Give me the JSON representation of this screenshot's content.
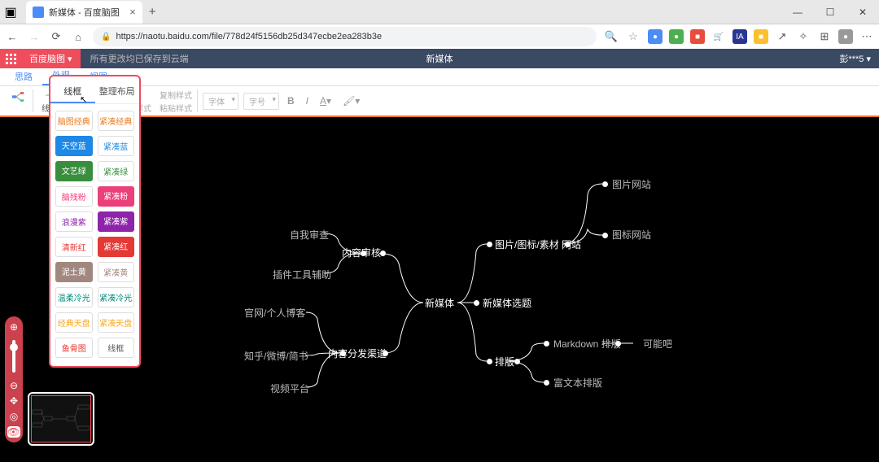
{
  "browser": {
    "tab_title": "新媒体 - 百度脑图",
    "url": "https://naotu.baidu.com/file/778d24f5156db25d347ecbe2ea283b3e"
  },
  "app": {
    "brand": "百度脑图",
    "save_status": "所有更改均已保存到云端",
    "doc_title": "新媒体",
    "user": "彭***5"
  },
  "tabs": {
    "t1": "思路",
    "t2": "外观",
    "t3": "视图"
  },
  "toolbar": {
    "theme_label": "线框",
    "arrange_label": "整理布局",
    "reset_style": "清除样式",
    "copy_style": "复制样式",
    "paste_style": "粘贴样式",
    "font_sel": "字体",
    "size_sel": "字号"
  },
  "theme_menu": {
    "tab_theme": "线框",
    "tab_arrange": "整理布局",
    "items": [
      {
        "label": "脑图经典",
        "bg": "#ffffff",
        "color": "#e67e22"
      },
      {
        "label": "紧凑经典",
        "bg": "#ffffff",
        "color": "#e67e22"
      },
      {
        "label": "天空蓝",
        "bg": "#1e88e5",
        "color": "#ffffff"
      },
      {
        "label": "紧凑蓝",
        "bg": "#ffffff",
        "color": "#1e88e5"
      },
      {
        "label": "文艺绿",
        "bg": "#388e3c",
        "color": "#ffffff"
      },
      {
        "label": "紧凑绿",
        "bg": "#ffffff",
        "color": "#388e3c"
      },
      {
        "label": "脑残粉",
        "bg": "#ffffff",
        "color": "#ec407a"
      },
      {
        "label": "紧凑粉",
        "bg": "#ec407a",
        "color": "#ffffff"
      },
      {
        "label": "浪漫紫",
        "bg": "#ffffff",
        "color": "#8e24aa"
      },
      {
        "label": "紧凑紫",
        "bg": "#8e24aa",
        "color": "#ffffff"
      },
      {
        "label": "清新红",
        "bg": "#ffffff",
        "color": "#e53935"
      },
      {
        "label": "紧凑红",
        "bg": "#e53935",
        "color": "#ffffff"
      },
      {
        "label": "泥土黄",
        "bg": "#a1887f",
        "color": "#ffffff"
      },
      {
        "label": "紧凑黄",
        "bg": "#ffffff",
        "color": "#a1887f"
      },
      {
        "label": "温柔冷光",
        "bg": "#ffffff",
        "color": "#00897b"
      },
      {
        "label": "紧凑冷光",
        "bg": "#ffffff",
        "color": "#00897b"
      },
      {
        "label": "经典天盘",
        "bg": "#ffffff",
        "color": "#f9a825"
      },
      {
        "label": "紧凑天盘",
        "bg": "#ffffff",
        "color": "#f9a825"
      },
      {
        "label": "鱼骨图",
        "bg": "#ffffff",
        "color": "#e53935"
      },
      {
        "label": "线框",
        "bg": "#ffffff",
        "color": "#555555"
      }
    ]
  },
  "mindmap": {
    "root": "新媒体",
    "l_content_review": "内容审核",
    "l_self_review": "自我审查",
    "l_plugin_help": "插件工具辅助",
    "l_channel": "内容分发渠道",
    "l_blog": "官网/个人博客",
    "l_zhihu": "知乎/微博/简书",
    "l_video": "视频平台",
    "r_topic": "新媒体选题",
    "r_assets": "图片/图标/素材 网站",
    "r_img_site": "图片网站",
    "r_icon_site": "图标网站",
    "r_layout": "排版",
    "r_markdown": "Markdown 排版",
    "r_richtext": "富文本排版",
    "r_maybe": "可能吧"
  }
}
